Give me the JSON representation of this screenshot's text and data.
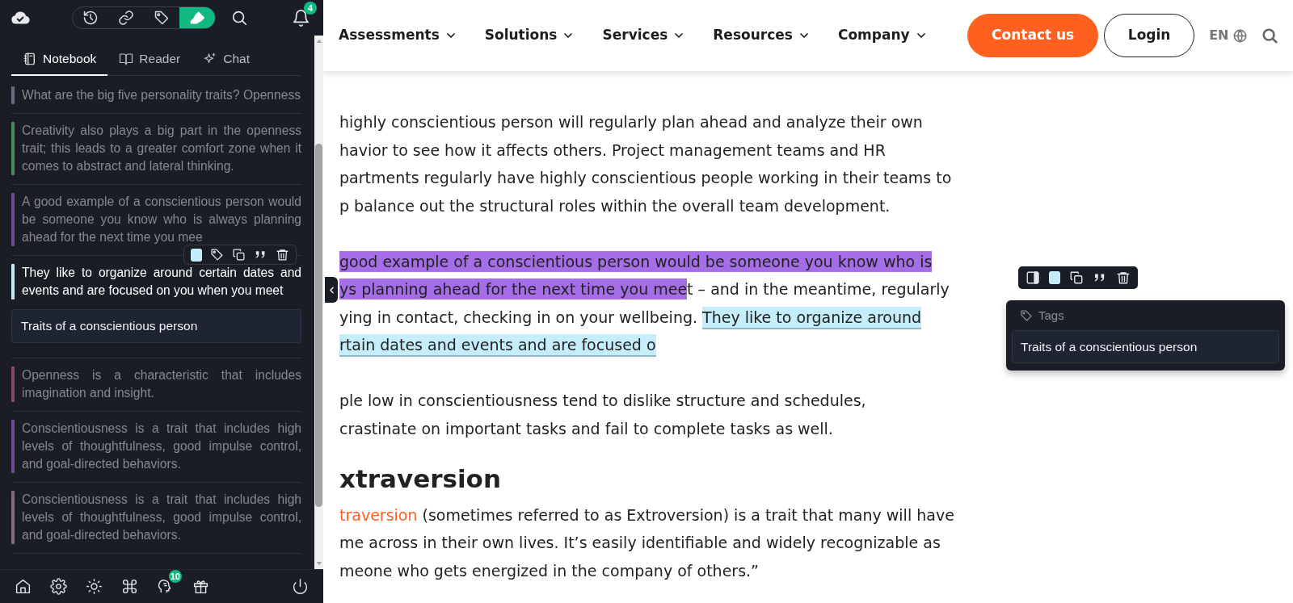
{
  "sidebar": {
    "top_buttons": [
      {
        "kind": "history",
        "selected": false
      },
      {
        "kind": "link",
        "selected": false
      },
      {
        "kind": "tag",
        "selected": false
      },
      {
        "kind": "highlighter",
        "selected": true
      }
    ],
    "notification_count": "4",
    "tabs": [
      {
        "label": "Notebook",
        "kind": "notebook",
        "selected": true
      },
      {
        "label": "Reader",
        "kind": "reader",
        "selected": false
      },
      {
        "label": "Chat",
        "kind": "chat",
        "selected": false
      }
    ],
    "notes": [
      {
        "text": "What are the big five personality traits? Openness",
        "color": "#6b6884",
        "selected": false
      },
      {
        "text": "Creativity also plays a big part in the openness trait; this leads to a greater comfort zone when it comes to abstract and lateral thinking.",
        "color": "#4f8a5f",
        "selected": false
      },
      {
        "text": "A good example of a conscientious person would be someone you know who is always planning ahead for the next time you mee",
        "color": "#6b4c9a",
        "selected": false
      },
      {
        "text": "They like to organize around certain dates and events and are focused on you when you meet",
        "color": "#c4ecfa",
        "selected": true,
        "tag_field": {
          "value": "Traits of a conscientious person"
        }
      },
      {
        "text": "Openness is a characteristic that includes imagination and insight.",
        "color": "#8a4a6a",
        "selected": false
      },
      {
        "text": "Conscientiousness is a trait that includes high levels of thoughtfulness, good impulse control, and goal-directed behaviors.",
        "color": "#6b4c9a",
        "selected": false
      },
      {
        "text": "Conscientiousness is a trait that includes high levels of thoughtfulness, good impulse control, and goal-directed behaviors.",
        "color": "#8a6a7a",
        "selected": false
      }
    ],
    "footer_buttons": [
      {
        "kind": "home"
      },
      {
        "kind": "settings"
      },
      {
        "kind": "theme"
      },
      {
        "kind": "shortcuts"
      },
      {
        "kind": "brain",
        "badge": "10"
      },
      {
        "kind": "gift"
      },
      {
        "kind": "power"
      }
    ]
  },
  "site": {
    "nav": [
      "Assessments",
      "Solutions",
      "Services",
      "Resources",
      "Company"
    ],
    "contact_button": "Contact us",
    "login_button": "Login",
    "language": "EN",
    "content": [
      {
        "kind": "paragraph",
        "lines": [
          [
            {
              "text": "highly conscientious person will regularly plan ahead and analyze their own"
            }
          ],
          [
            {
              "text": "havior to see how it affects others. Project management teams and HR"
            }
          ],
          [
            {
              "text": "partments regularly have highly conscientious people working in their teams to"
            }
          ],
          [
            {
              "text": "p balance out the structural roles within the overall team development."
            }
          ]
        ]
      },
      {
        "kind": "paragraph",
        "lines": [
          [
            {
              "text": "good example of a conscientious person would be someone you know who is",
              "color": "#a66de8"
            }
          ],
          [
            {
              "text": "ys planning ahead for the next time you mee",
              "color": "#a66de8"
            },
            {
              "text": "t – and in the meantime, regularly"
            }
          ],
          [
            {
              "text": "ying in contact, checking in on your wellbeing. "
            },
            {
              "text": "They like to organize around",
              "color": "#c5eefa"
            }
          ],
          [
            {
              "text": "rtain dates and events and are focused o",
              "color": "#c5eefa"
            }
          ]
        ]
      },
      {
        "kind": "paragraph",
        "lines": [
          [
            {
              "text": "ple low in conscientiousness tend to dislike structure and schedules,"
            }
          ],
          [
            {
              "text": "crastinate on important tasks and fail to complete tasks as well."
            }
          ]
        ]
      },
      {
        "kind": "heading",
        "text": "xtraversion"
      },
      {
        "kind": "paragraph",
        "lines": [
          [
            {
              "text": "traversion",
              "link": true
            },
            {
              "text": " (sometimes referred to as Extroversion) is a trait that many will have"
            }
          ],
          [
            {
              "text": "me across in their own lives. It’s easily identifiable and widely recognizable as"
            }
          ],
          [
            {
              "text": "meone who gets energized in the company of others.”"
            }
          ]
        ]
      }
    ]
  },
  "tags_popup": {
    "title": "Tags",
    "value": "Traits of a conscientious person"
  }
}
